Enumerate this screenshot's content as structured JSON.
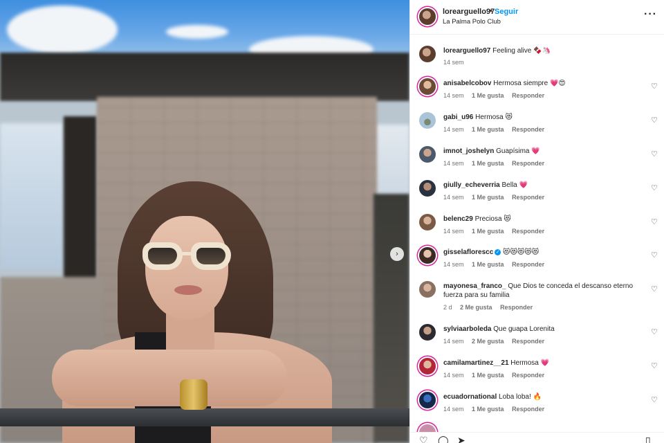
{
  "post": {
    "username": "lorearguello97",
    "follow_label": "Seguir",
    "separator": "•",
    "location": "La Palma Polo Club",
    "more_icon": "more-horizontal-icon",
    "caption": "Feeling alive 🍫🦄",
    "caption_time": "14 sem"
  },
  "carousel": {
    "next_icon": "chevron-right-icon",
    "next_glyph": "›"
  },
  "comments": [
    {
      "user": "anisabelcobov",
      "text": "Hermosa siempre 💗😍",
      "time": "14 sem",
      "likes": "1 Me gusta",
      "reply": "Responder"
    },
    {
      "user": "gabi_u96",
      "text": "Hermosa 😻",
      "time": "14 sem",
      "likes": "1 Me gusta",
      "reply": "Responder"
    },
    {
      "user": "imnot_joshelyn",
      "text": "Guapísima 💗",
      "time": "14 sem",
      "likes": "1 Me gusta",
      "reply": "Responder"
    },
    {
      "user": "giully_echeverria",
      "text": "Bella 💗",
      "time": "14 sem",
      "likes": "1 Me gusta",
      "reply": "Responder"
    },
    {
      "user": "belenc29",
      "text": "Preciosa 😻",
      "time": "14 sem",
      "likes": "1 Me gusta",
      "reply": "Responder"
    },
    {
      "user": "gisselaflorescc",
      "verified": true,
      "text": "😻😻😻😻😻",
      "time": "14 sem",
      "likes": "1 Me gusta",
      "reply": "Responder"
    },
    {
      "user": "mayonesa_franco_",
      "text": "Que Dios te conceda el descanso eterno fuerza para su familia",
      "time": "2 d",
      "likes": "2 Me gusta",
      "reply": "Responder"
    },
    {
      "user": "sylviaarboleda",
      "text": "Que guapa Lorenita",
      "time": "14 sem",
      "likes": "2 Me gusta",
      "reply": "Responder"
    },
    {
      "user": "camilamartinez__21",
      "text": "Hermosa 💗",
      "time": "14 sem",
      "likes": "1 Me gusta",
      "reply": "Responder"
    },
    {
      "user": "ecuadornational",
      "text": "Loba loba! 🔥",
      "time": "14 sem",
      "likes": "1 Me gusta",
      "reply": "Responder"
    }
  ],
  "icons": {
    "heart": "heart-icon",
    "comment": "comment-icon",
    "share": "share-icon",
    "save": "bookmark-icon"
  },
  "colors": {
    "accent": "#0095f6",
    "text": "#262626",
    "muted": "#737373",
    "story_ring": "#d6249f"
  }
}
